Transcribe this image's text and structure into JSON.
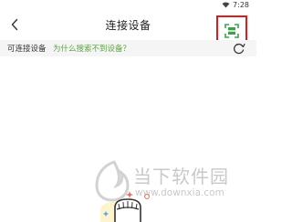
{
  "status_bar": {
    "time": "7:28"
  },
  "header": {
    "title": "连接设备",
    "back_icon": "chevron-left-icon",
    "scan_icon": "scan-icon",
    "scan_highlight_color": "#e01b1b"
  },
  "sub_bar": {
    "available_label": "可连接设备",
    "help_link": "为什么搜索不到设备？",
    "help_link_color": "#5aa640",
    "refresh_icon": "refresh-icon"
  },
  "watermark": {
    "name": "当下软件园",
    "url": "www.downxia.com"
  }
}
